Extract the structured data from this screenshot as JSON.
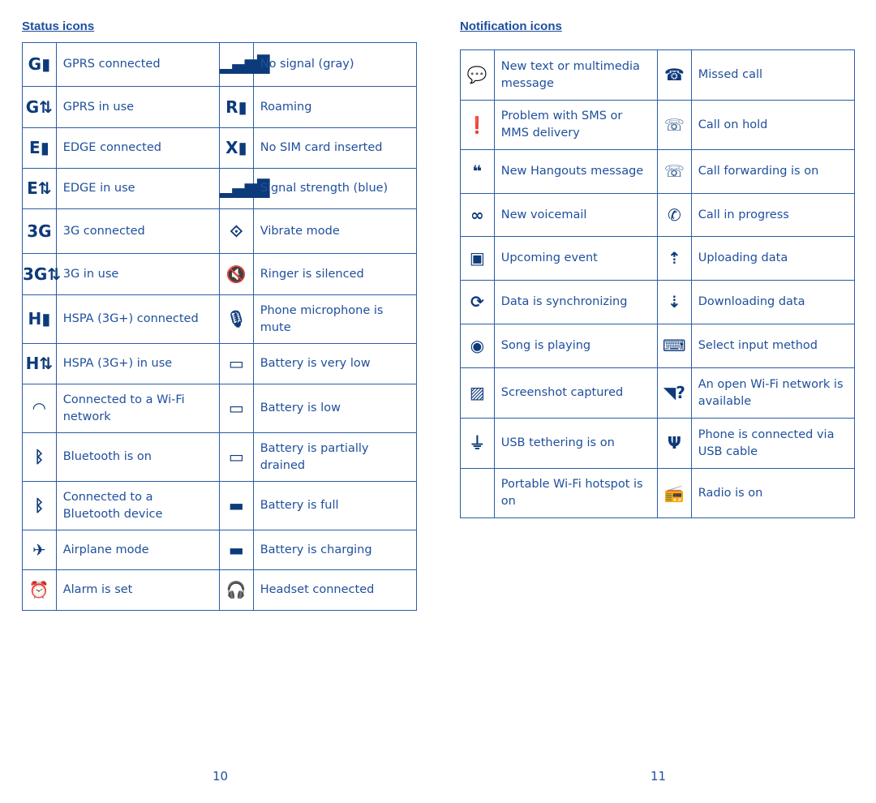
{
  "status": {
    "title": "Status icons",
    "rows": [
      [
        {
          "icon": "gprs-connected-icon",
          "glyph": "G▮",
          "label": "GPRS connected"
        },
        {
          "icon": "no-signal-icon",
          "glyph": "▂▄▆█",
          "label": "No signal (gray)"
        }
      ],
      [
        {
          "icon": "gprs-in-use-icon",
          "glyph": "G⇅",
          "label": "GPRS in use"
        },
        {
          "icon": "roaming-icon",
          "glyph": "R▮",
          "label": "Roaming"
        }
      ],
      [
        {
          "icon": "edge-connected-icon",
          "glyph": "E▮",
          "label": "EDGE connected"
        },
        {
          "icon": "no-sim-icon",
          "glyph": "X▮",
          "label": "No SIM card inserted"
        }
      ],
      [
        {
          "icon": "edge-in-use-icon",
          "glyph": "E⇅",
          "label": "EDGE in use"
        },
        {
          "icon": "signal-strength-icon",
          "glyph": "▂▄▆█",
          "label": "Signal strength (blue)"
        }
      ],
      [
        {
          "icon": "3g-connected-icon",
          "glyph": "3G",
          "label": "3G connected"
        },
        {
          "icon": "vibrate-icon",
          "glyph": "⟐",
          "label": "Vibrate mode"
        }
      ],
      [
        {
          "icon": "3g-in-use-icon",
          "glyph": "3G⇅",
          "label": "3G in use"
        },
        {
          "icon": "ringer-silenced-icon",
          "glyph": "🔇",
          "label": "Ringer is silenced"
        }
      ],
      [
        {
          "icon": "hspa-connected-icon",
          "glyph": "H▮",
          "label": "HSPA (3G+) connected"
        },
        {
          "icon": "mic-mute-icon",
          "glyph": "🎙",
          "label": "Phone microphone is mute"
        }
      ],
      [
        {
          "icon": "hspa-in-use-icon",
          "glyph": "H⇅",
          "label": "HSPA (3G+) in use"
        },
        {
          "icon": "battery-very-low-icon",
          "glyph": "▭",
          "label": "Battery is very low"
        }
      ],
      [
        {
          "icon": "wifi-icon",
          "glyph": "◠",
          "label": "Connected to a Wi-Fi network"
        },
        {
          "icon": "battery-low-icon",
          "glyph": "▭",
          "label": "Battery is low"
        }
      ],
      [
        {
          "icon": "bluetooth-icon",
          "glyph": "ᛒ",
          "label": "Bluetooth is on"
        },
        {
          "icon": "battery-partial-icon",
          "glyph": "▭",
          "label": "Battery is partially drained"
        }
      ],
      [
        {
          "icon": "bluetooth-connected-icon",
          "glyph": "ᛒ",
          "label": "Connected to a Bluetooth device"
        },
        {
          "icon": "battery-full-icon",
          "glyph": "▬",
          "label": "Battery is full"
        }
      ],
      [
        {
          "icon": "airplane-icon",
          "glyph": "✈",
          "label": "Airplane mode"
        },
        {
          "icon": "battery-charging-icon",
          "glyph": "▬",
          "label": "Battery is charging"
        }
      ],
      [
        {
          "icon": "alarm-icon",
          "glyph": "⏰",
          "label": "Alarm is set"
        },
        {
          "icon": "headset-icon",
          "glyph": "🎧",
          "label": "Headset connected"
        }
      ]
    ]
  },
  "notification": {
    "title": "Notification icons",
    "rows": [
      [
        {
          "icon": "message-icon",
          "glyph": "💬",
          "label": "New text or multimedia message"
        },
        {
          "icon": "missed-call-icon",
          "glyph": "☎",
          "label": "Missed call"
        }
      ],
      [
        {
          "icon": "sms-problem-icon",
          "glyph": "❗",
          "label": "Problem with SMS or MMS delivery"
        },
        {
          "icon": "call-hold-icon",
          "glyph": "☏",
          "label": "Call on hold"
        }
      ],
      [
        {
          "icon": "hangouts-icon",
          "glyph": "❝",
          "label": "New Hangouts message"
        },
        {
          "icon": "call-forwarding-icon",
          "glyph": "☏",
          "label": "Call forwarding is on"
        }
      ],
      [
        {
          "icon": "voicemail-icon",
          "glyph": "∞",
          "label": "New voicemail"
        },
        {
          "icon": "call-in-progress-icon",
          "glyph": "✆",
          "label": "Call in progress"
        }
      ],
      [
        {
          "icon": "calendar-icon",
          "glyph": "▣",
          "label": "Upcoming event"
        },
        {
          "icon": "upload-icon",
          "glyph": "⇡",
          "label": "Uploading data"
        }
      ],
      [
        {
          "icon": "sync-icon",
          "glyph": "⟳",
          "label": "Data is synchronizing"
        },
        {
          "icon": "download-icon",
          "glyph": "⇣",
          "label": "Downloading data"
        }
      ],
      [
        {
          "icon": "song-playing-icon",
          "glyph": "◉",
          "label": "Song is playing"
        },
        {
          "icon": "keyboard-icon",
          "glyph": "⌨",
          "label": "Select input method"
        }
      ],
      [
        {
          "icon": "screenshot-icon",
          "glyph": "▨",
          "label": "Screenshot captured"
        },
        {
          "icon": "open-wifi-icon",
          "glyph": "◥?",
          "label": "An open Wi-Fi network is available"
        }
      ],
      [
        {
          "icon": "usb-tethering-icon",
          "glyph": "⏚",
          "label": "USB tethering is on"
        },
        {
          "icon": "usb-icon",
          "glyph": "Ψ",
          "label": "Phone is connected via USB cable"
        }
      ],
      [
        {
          "icon": "",
          "glyph": "",
          "label": "Portable Wi-Fi hotspot is on"
        },
        {
          "icon": "radio-icon",
          "glyph": "📻",
          "label": "Radio is on"
        }
      ]
    ]
  },
  "page_numbers": [
    "10",
    "11"
  ],
  "colors": {
    "text": "#1f4f9c",
    "border": "#2a5ca8",
    "icon": "#0d3a7a"
  }
}
